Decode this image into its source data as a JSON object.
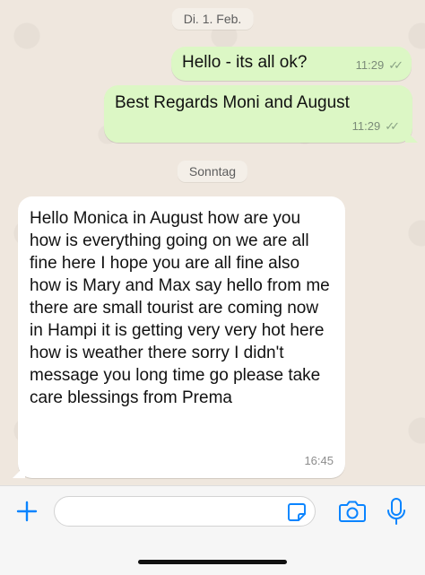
{
  "chat": {
    "date_separators": [
      "Di. 1. Feb.",
      "Sonntag"
    ],
    "messages": [
      {
        "direction": "outgoing",
        "text": "Hello - its all ok?",
        "time": "11:29",
        "status": "read"
      },
      {
        "direction": "outgoing",
        "text": "Best Regards Moni and August",
        "time": "11:29",
        "status": "read"
      },
      {
        "direction": "incoming",
        "text": "Hello Monica in August how are you how is everything going on we are all fine here I hope you are all fine also how is Mary and Max say hello from me there are small tourist are coming now in Hampi it is getting very very hot here how is weather there sorry I didn't message you long time go please take care blessings from Prema",
        "time": "16:45"
      }
    ]
  },
  "composer": {
    "input_value": "",
    "icons": {
      "attach": "plus-icon",
      "sticker": "sticker-icon",
      "camera": "camera-icon",
      "microphone": "microphone-icon"
    },
    "accent_color": "#0a84ff"
  },
  "colors": {
    "outgoing_bubble": "#dcf7c5",
    "incoming_bubble": "#ffffff",
    "chat_background": "#efe7de"
  }
}
